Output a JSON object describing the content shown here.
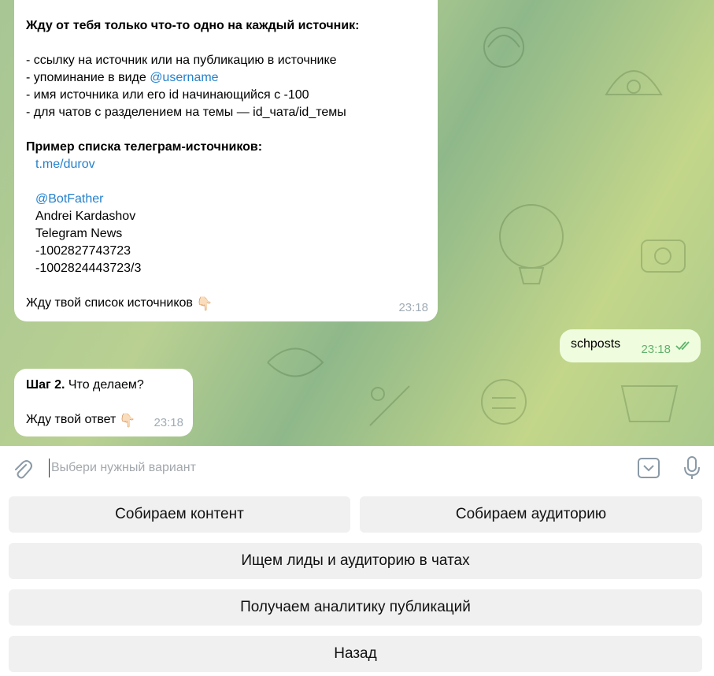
{
  "messages": {
    "step1": {
      "header": "Жду от тебя только что-то одно на каждый источник:",
      "items": [
        "- ссылку на источник или на публикацию в источнике",
        "- упоминание в виде ",
        "- имя источника или его id начинающийся с -100",
        "- для чатов с разделением на темы — id_чата/id_темы"
      ],
      "mention": "@username",
      "example_title": "Пример списка телеграм-источников:",
      "example_link": "t.me/durov",
      "example_mention": "@BotFather",
      "example_lines": [
        "Andrei Kardashov",
        "Telegram News",
        "-1002827743723",
        "-1002824443723/3"
      ],
      "footer": "Жду твой список источников",
      "time": "23:18"
    },
    "outgoing": {
      "text": "schposts",
      "time": "23:18"
    },
    "step2": {
      "step_label": "Шаг 2.",
      "question": " Что делаем?",
      "footer": "Жду твой ответ",
      "time": "23:18"
    }
  },
  "input": {
    "placeholder": "Выбери нужный вариант",
    "value": ""
  },
  "keyboard": {
    "row1": [
      "Собираем контент",
      "Собираем аудиторию"
    ],
    "leads": "Ищем лиды и аудиторию в чатах",
    "analytics": "Получаем аналитику публикаций",
    "back": "Назад"
  },
  "icons": {
    "attach": "paperclip-icon",
    "keyboard_toggle": "chevron-down-icon",
    "mic": "microphone-icon",
    "read_receipt": "double-check-icon",
    "pointing": "pointing-down-hand-icon"
  },
  "colors": {
    "link": "#2481cc",
    "outgoing_bubble": "#effdde",
    "outgoing_time": "#62b16e",
    "keyboard_button": "#f0f0f0"
  }
}
